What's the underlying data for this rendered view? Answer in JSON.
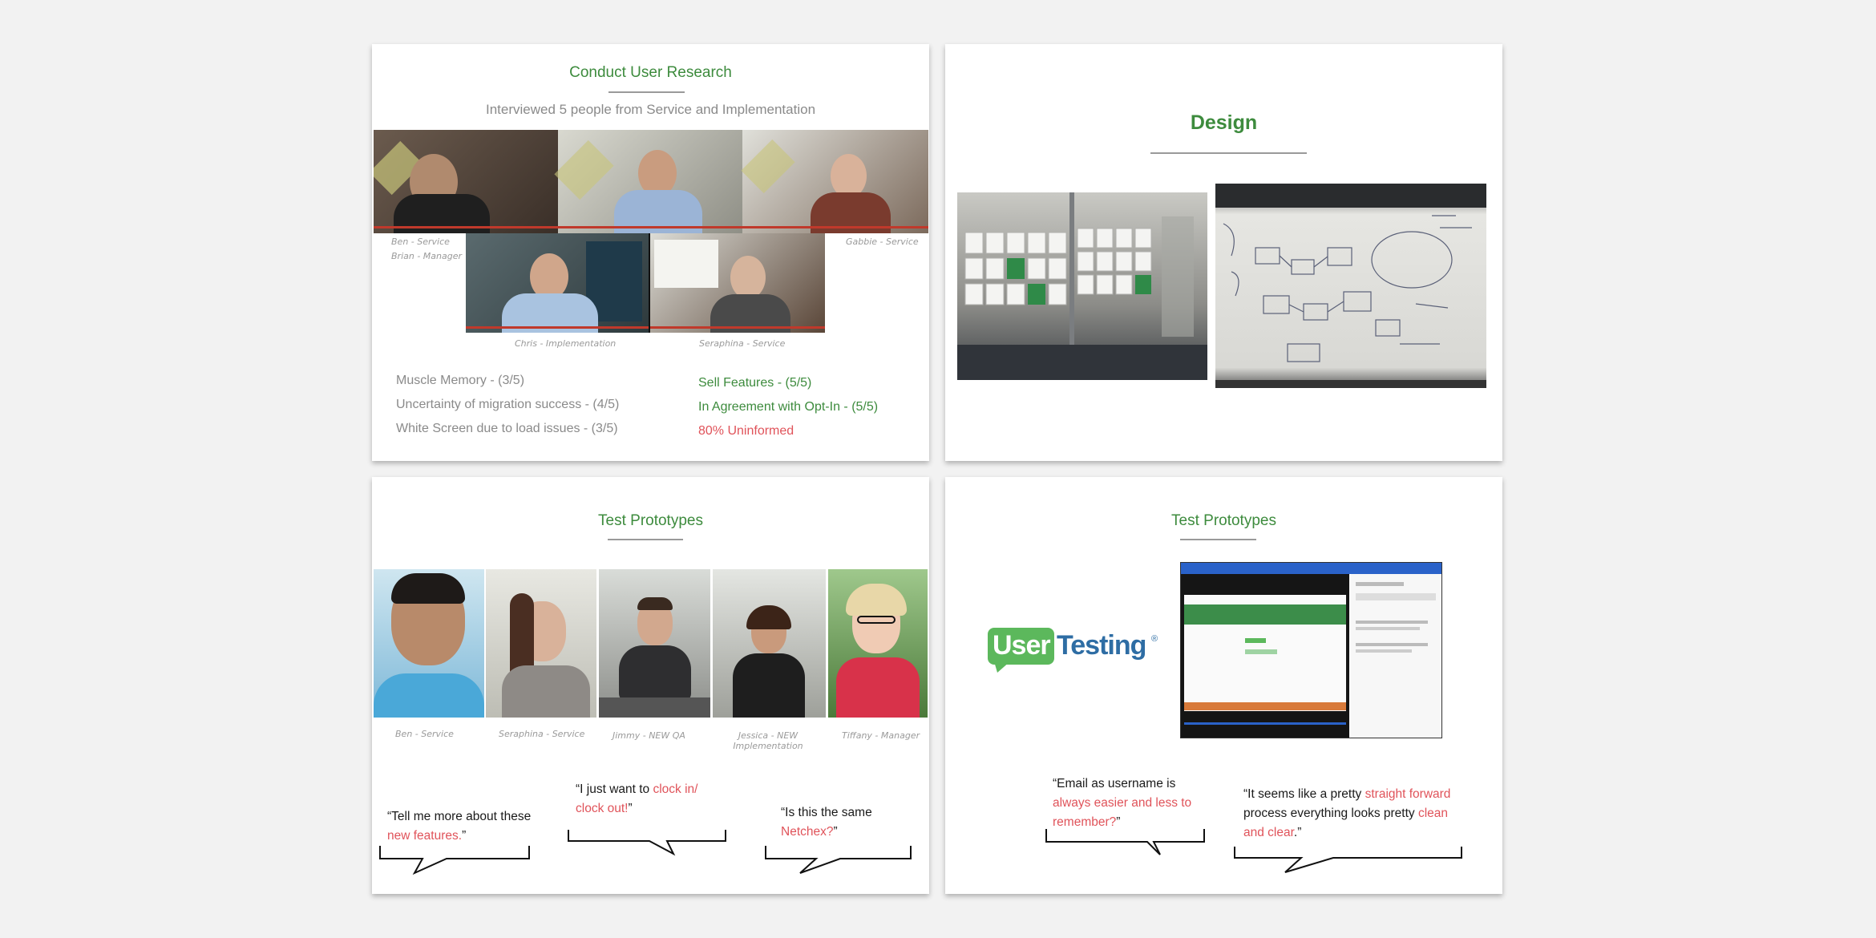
{
  "slide1": {
    "title": "Conduct User Research",
    "subtitle": "Interviewed 5 people from Service and Implementation",
    "captions": {
      "ben_brian_1": "Ben - Service",
      "ben_brian_2": "Brian - Manager",
      "gabbie": "Gabbie - Service",
      "chris": "Chris - Implementation",
      "seraphina": "Seraphina - Service"
    },
    "stats_left": [
      "Muscle Memory - (3/5)",
      "Uncertainty of migration success - (4/5)",
      "White Screen due to load issues - (3/5)"
    ],
    "stats_right": [
      "Sell Features - (5/5)",
      "In Agreement with Opt-In - (5/5)",
      "80% Uninformed"
    ]
  },
  "slide2": {
    "title": "Design"
  },
  "slide3": {
    "title": "Test Prototypes",
    "captions": [
      "Ben - Service",
      "Seraphina - Service",
      "Jimmy - NEW QA",
      "Jessica - NEW Implementation",
      "Tiffany - Manager"
    ],
    "quotes": {
      "q1": {
        "pre": "“Tell me more about these ",
        "hl": "new features.",
        "post": "”"
      },
      "q2": {
        "pre": "“I just want to ",
        "hl": "clock in/ clock out!",
        "post": "”"
      },
      "q3": {
        "pre": "“Is this the same ",
        "hl": "Netchex?",
        "post": "”"
      }
    }
  },
  "slide4": {
    "title": "Test Prototypes",
    "logo": {
      "part1": "User",
      "part2": "Testing",
      "mark": "®"
    },
    "quotes": {
      "q1": {
        "pre": "“Email as username is ",
        "hl": "always easier and less to remember?",
        "post": "”"
      },
      "q2": {
        "pre": "“It seems like a pretty ",
        "hl": "straight forward",
        "mid": " process everything looks pretty ",
        "hl2": "clean and clear",
        "post": ".”"
      }
    }
  },
  "colors": {
    "accent_green": "#3d8b3d",
    "highlight_red": "#e0535a",
    "usertesting_green": "#5cb85c",
    "usertesting_blue": "#2e6da4"
  }
}
